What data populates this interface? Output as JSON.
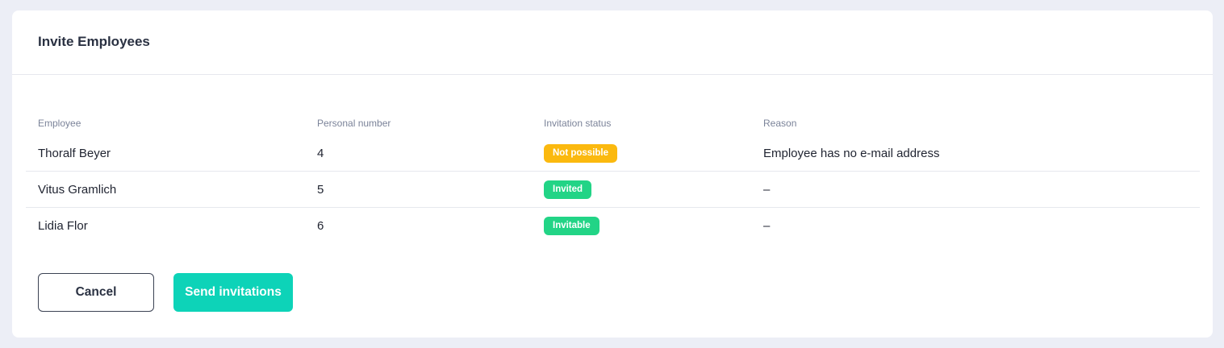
{
  "card": {
    "title": "Invite Employees"
  },
  "table": {
    "columns": {
      "employee": "Employee",
      "personal_number": "Personal number",
      "invitation_status": "Invitation status",
      "reason": "Reason"
    },
    "rows": [
      {
        "employee": "Thoralf Beyer",
        "personal_number": "4",
        "status": "Not possible",
        "status_color": "#fbb90f",
        "reason": "Employee has no e-mail address"
      },
      {
        "employee": "Vitus Gramlich",
        "personal_number": "5",
        "status": "Invited",
        "status_color": "#22d486",
        "reason": "–"
      },
      {
        "employee": "Lidia Flor",
        "personal_number": "6",
        "status": "Invitable",
        "status_color": "#22d486",
        "reason": "–"
      }
    ]
  },
  "actions": {
    "cancel_label": "Cancel",
    "send_label": "Send invitations"
  },
  "colors": {
    "page_background": "#eceef6",
    "primary": "#0dd3b8",
    "warning": "#fbb90f",
    "success": "#22d486"
  }
}
